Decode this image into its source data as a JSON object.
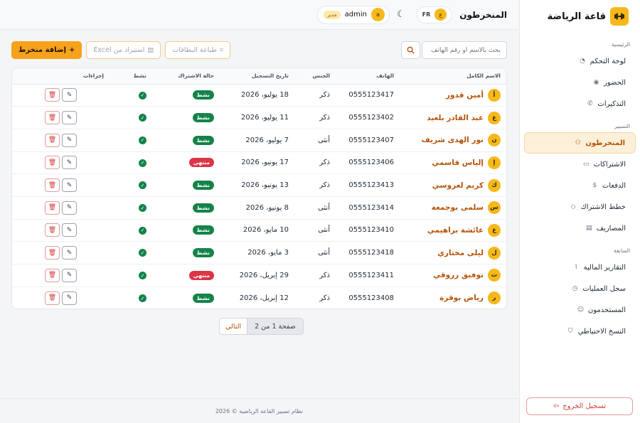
{
  "brand": {
    "name": "قاعة الرياضة",
    "logo_icon": "dumbbell-icon"
  },
  "sidebar": {
    "sections": [
      {
        "title": "الرئيسية",
        "items": [
          {
            "label": "لوحة التحكم",
            "icon": "dashboard-icon"
          },
          {
            "label": "الحضور",
            "icon": "attendance-icon"
          },
          {
            "label": "التذكيرات",
            "icon": "whatsapp-icon"
          }
        ]
      },
      {
        "title": "التسيير",
        "items": [
          {
            "label": "المنخرطون",
            "icon": "members-icon",
            "active": true
          },
          {
            "label": "الاشتراكات",
            "icon": "card-icon"
          },
          {
            "label": "الدفعات",
            "icon": "payment-icon"
          },
          {
            "label": "خطط الاشتراك",
            "icon": "tag-icon"
          },
          {
            "label": "المصاريف",
            "icon": "receipt-icon"
          }
        ]
      },
      {
        "title": "المتابعة",
        "items": [
          {
            "label": "التقارير المالية",
            "icon": "chart-icon"
          },
          {
            "label": "سجل العمليات",
            "icon": "clock-icon"
          },
          {
            "label": "المستخدمون",
            "icon": "user-icon"
          },
          {
            "label": "النسخ الاحتياطي",
            "icon": "shield-icon"
          }
        ]
      }
    ],
    "logout_label": "تسجيل الخروج"
  },
  "header": {
    "title": "المنخرطون",
    "lang_initial": "ع",
    "lang_code": "FR",
    "user_initial": "a",
    "user_name": "admin",
    "user_role": "مدير"
  },
  "toolbar": {
    "search_placeholder": "بحث بالاسم أو رقم الهاتف",
    "print_cards_label": "طباعة البطاقات",
    "import_excel_label": "استيراد من Excel",
    "add_member_label": "إضافة منخرط"
  },
  "table": {
    "columns": [
      "الاسم الكامل",
      "الهاتف",
      "الجنس",
      "تاريخ التسجيل",
      "حالة الاشتراك",
      "نشط",
      "إجراءات"
    ],
    "rows": [
      {
        "initial": "أ",
        "name": "أمين قدور",
        "phone": "0555123417",
        "gender": "ذكر",
        "date": "18 يوليو، 2026",
        "status": "نشط",
        "status_kind": "ok"
      },
      {
        "initial": "ع",
        "name": "عبد القادر بلعيد",
        "phone": "0555123402",
        "gender": "ذكر",
        "date": "11 يوليو، 2026",
        "status": "نشط",
        "status_kind": "ok"
      },
      {
        "initial": "ن",
        "name": "نور الهدى شريف",
        "phone": "0555123407",
        "gender": "أنثى",
        "date": "7 يوليو، 2026",
        "status": "نشط",
        "status_kind": "ok"
      },
      {
        "initial": "إ",
        "name": "إلياس قاسمي",
        "phone": "0555123406",
        "gender": "ذكر",
        "date": "17 يونيو، 2026",
        "status": "منتهي",
        "status_kind": "bad"
      },
      {
        "initial": "ك",
        "name": "كريم لعروسي",
        "phone": "0555123413",
        "gender": "ذكر",
        "date": "13 يونيو، 2026",
        "status": "نشط",
        "status_kind": "ok"
      },
      {
        "initial": "س",
        "name": "سلمى بوجمعة",
        "phone": "0555123414",
        "gender": "أنثى",
        "date": "8 يونيو، 2026",
        "status": "نشط",
        "status_kind": "ok"
      },
      {
        "initial": "ع",
        "name": "عائشة براهيمي",
        "phone": "0555123410",
        "gender": "أنثى",
        "date": "10 مايو، 2026",
        "status": "نشط",
        "status_kind": "ok"
      },
      {
        "initial": "ل",
        "name": "ليلى مختاري",
        "phone": "0555123418",
        "gender": "أنثى",
        "date": "3 مايو، 2026",
        "status": "نشط",
        "status_kind": "ok"
      },
      {
        "initial": "ت",
        "name": "توفيق زروقي",
        "phone": "0555123411",
        "gender": "ذكر",
        "date": "29 إبريل، 2026",
        "status": "منتهي",
        "status_kind": "bad"
      },
      {
        "initial": "ر",
        "name": "رياض بوقرة",
        "phone": "0555123408",
        "gender": "ذكر",
        "date": "12 إبريل، 2026",
        "status": "نشط",
        "status_kind": "ok"
      }
    ]
  },
  "pagination": {
    "info": "صفحة 1 من 2",
    "next_label": "التالي"
  },
  "footer": {
    "text": "نظام تسيير القاعة الرياضية © 2026"
  },
  "colors": {
    "accent": "#f7a21b",
    "active_green": "#14834a",
    "expired_red": "#dc3545",
    "name_orange": "#b45309"
  }
}
